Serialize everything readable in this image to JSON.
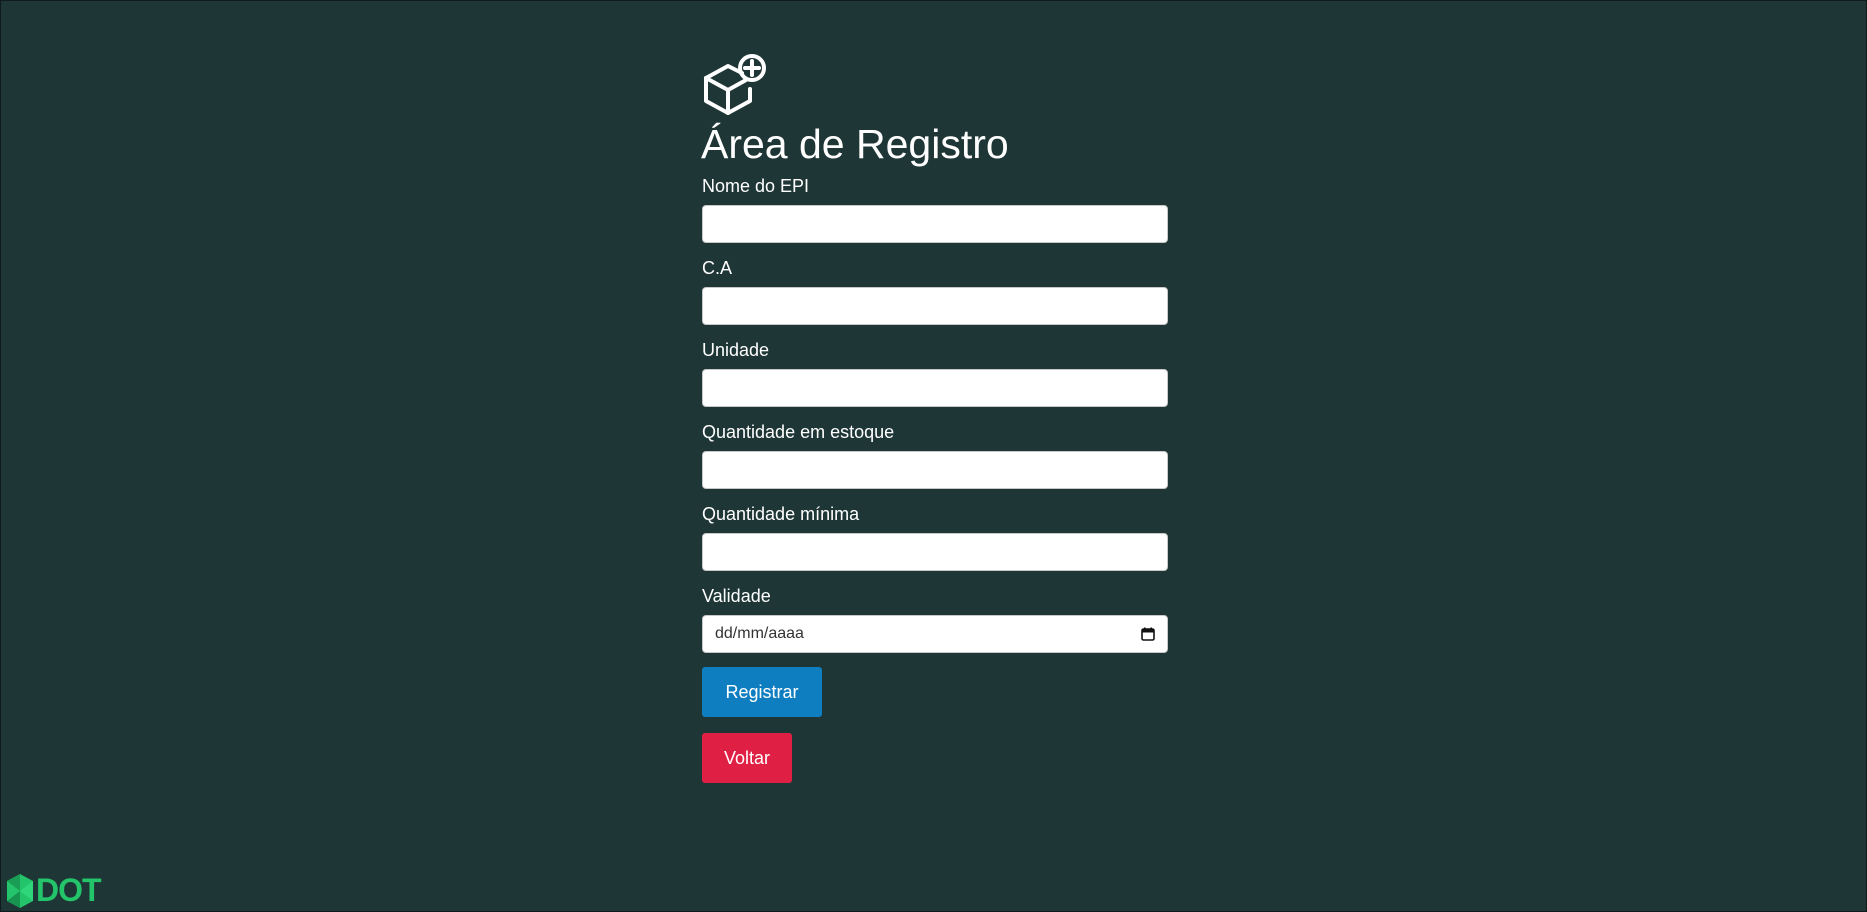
{
  "header": {
    "icon": "box-add-icon",
    "title": "Área de Registro"
  },
  "form": {
    "fields": [
      {
        "label": "Nome do EPI",
        "value": ""
      },
      {
        "label": "C.A",
        "value": ""
      },
      {
        "label": "Unidade",
        "value": ""
      },
      {
        "label": "Quantidade em estoque",
        "value": ""
      },
      {
        "label": "Quantidade mínima",
        "value": ""
      }
    ],
    "date_field": {
      "label": "Validade",
      "placeholder": "dd/mm/aaaa",
      "icon": "calendar-icon"
    },
    "register_label": "Registrar",
    "back_label": "Voltar"
  },
  "logo": {
    "text": "DOT",
    "icon": "hexagon-logo-icon"
  },
  "colors": {
    "background": "#1f3636",
    "primary": "#0f7ec1",
    "danger": "#e01f44",
    "brand": "#23c46a"
  }
}
